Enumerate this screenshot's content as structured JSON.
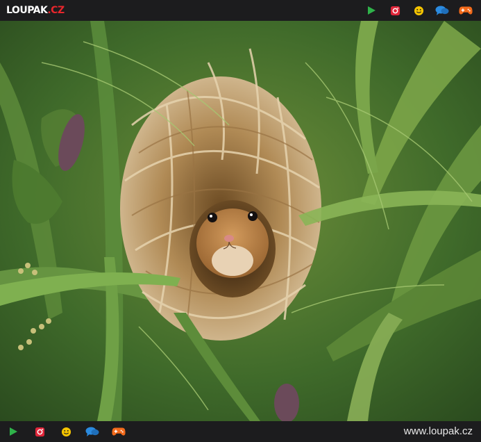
{
  "header": {
    "logo_main": "LOUPAK",
    "logo_tld": ".CZ",
    "icons": [
      "play-icon",
      "instagram-icon",
      "smiley-icon",
      "chat-icon",
      "gamepad-icon"
    ]
  },
  "footer": {
    "url": "www.loupak.cz",
    "icons": [
      "play-icon",
      "instagram-icon",
      "smiley-icon",
      "chat-icon",
      "gamepad-icon"
    ]
  },
  "photo": {
    "subject": "harvest mouse peeking out of a woven grass nest"
  },
  "colors": {
    "bar_bg": "#1c1c1e",
    "accent_red": "#e8262c",
    "play_green": "#2fb24a",
    "instagram_red": "#e0263a",
    "smiley_yellow": "#f5c400",
    "chat_blue": "#2b8be0",
    "gamepad_orange": "#f26a1b"
  }
}
